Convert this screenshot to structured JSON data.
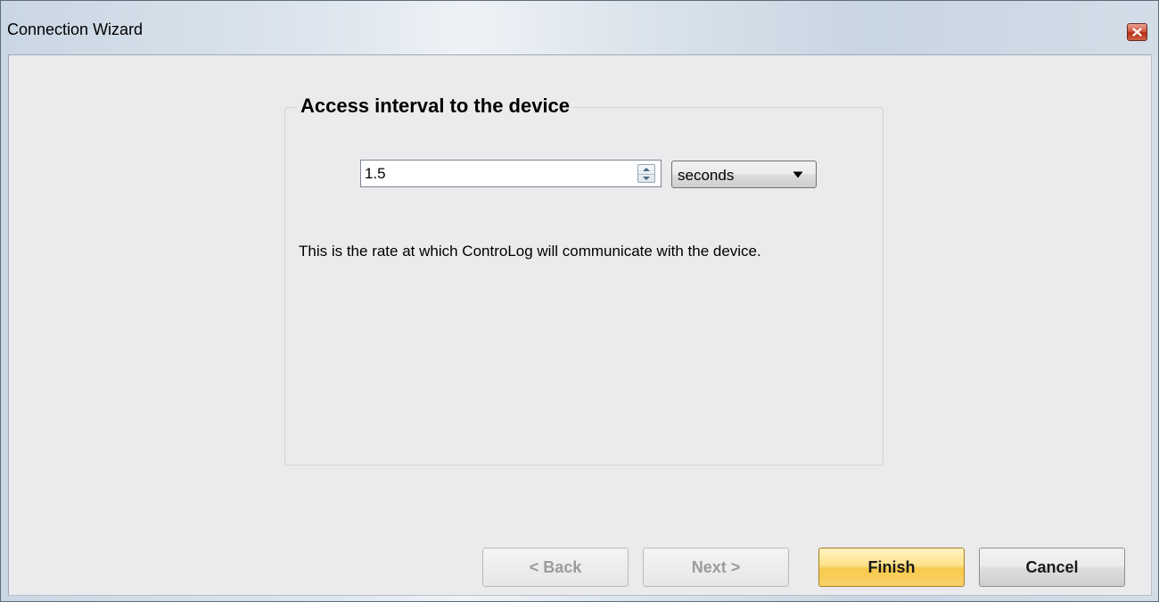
{
  "window": {
    "title": "Connection Wizard"
  },
  "group": {
    "title": "Access interval to the device"
  },
  "interval": {
    "value": "1.5"
  },
  "unit": {
    "selected": "seconds"
  },
  "description": "This is the rate at which ControLog will communicate with the device.",
  "buttons": {
    "back": "< Back",
    "next": "Next >",
    "finish": "Finish",
    "cancel": "Cancel"
  },
  "icons": {
    "close": "close-icon",
    "spin_up": "chevron-up-icon",
    "spin_down": "chevron-down-icon",
    "dropdown": "caret-down-icon"
  },
  "colors": {
    "close_button": "#c8412a",
    "finish_button": "#f8c94b",
    "client_background": "#ebebed"
  }
}
